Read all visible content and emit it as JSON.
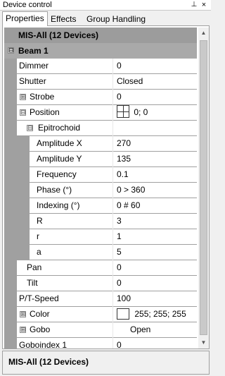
{
  "window": {
    "title": "Device control",
    "pin_glyph": "⊥",
    "close_glyph": "×"
  },
  "tabs": [
    {
      "label": "Properties",
      "active": true
    },
    {
      "label": "Effects",
      "active": false
    },
    {
      "label": "Group Handling",
      "active": false
    }
  ],
  "grid": {
    "header": "MIS-All (12 Devices)",
    "category": "Beam 1",
    "rows": [
      {
        "name": "Dimmer",
        "value": "0"
      },
      {
        "name": "Shutter",
        "value": "Closed"
      },
      {
        "name": "Strobe",
        "value": "0"
      },
      {
        "name": "Position",
        "value": "0; 0"
      },
      {
        "name": "Epitrochoid",
        "value": ""
      },
      {
        "name": "Amplitude X",
        "value": "270"
      },
      {
        "name": "Amplitude Y",
        "value": "135"
      },
      {
        "name": "Frequency",
        "value": "0.1"
      },
      {
        "name": "Phase (°)",
        "value": "0 > 360"
      },
      {
        "name": "Indexing (°)",
        "value": "0 # 60"
      },
      {
        "name": "R",
        "value": "3"
      },
      {
        "name": "r",
        "value": "1"
      },
      {
        "name": "a",
        "value": "5"
      },
      {
        "name": "Pan",
        "value": "0"
      },
      {
        "name": "Tilt",
        "value": "0"
      },
      {
        "name": "P/T-Speed",
        "value": "100"
      },
      {
        "name": "Color",
        "value": "255; 255; 255"
      },
      {
        "name": "Gobo",
        "value": "Open"
      },
      {
        "name": "Goboindex 1",
        "value": "0"
      }
    ]
  },
  "description": {
    "title": "MIS-All (12 Devices)"
  },
  "icons": {
    "collapse": "⊟",
    "expand": "⊞",
    "scroll_up": "▲",
    "scroll_down": "▼"
  },
  "colors": {
    "header_bg": "#9c9c9c",
    "row_gutter": "#a0a0a0",
    "color_swatch": "#ffffff"
  }
}
